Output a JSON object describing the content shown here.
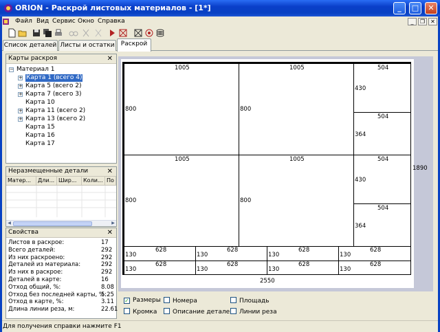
{
  "window": {
    "title": "ORION - Раскрой листовых материалов - [1*]",
    "minimize": "_",
    "maximize": "□",
    "close": "✕"
  },
  "menu": [
    "Файл",
    "Вид",
    "Сервис",
    "Окно",
    "Справка"
  ],
  "tabs": [
    "Список деталей",
    "Листы и остатки",
    "Раскрой"
  ],
  "cards_panel": {
    "title": "Карты раскроя",
    "close": "✕",
    "root": "Материал 1",
    "items": [
      {
        "label": "Карта  1  (всего 4)",
        "expandable": true,
        "selected": true
      },
      {
        "label": "Карта  5  (всего 2)",
        "expandable": true,
        "selected": false
      },
      {
        "label": "Карта  7  (всего 3)",
        "expandable": true,
        "selected": false
      },
      {
        "label": "Карта  10",
        "expandable": false,
        "selected": false
      },
      {
        "label": "Карта  11  (всего 2)",
        "expandable": true,
        "selected": false
      },
      {
        "label": "Карта  13  (всего 2)",
        "expandable": true,
        "selected": false
      },
      {
        "label": "Карта  15",
        "expandable": false,
        "selected": false
      },
      {
        "label": "Карта  16",
        "expandable": false,
        "selected": false
      },
      {
        "label": "Карта  17",
        "expandable": false,
        "selected": false
      }
    ]
  },
  "unplaced_panel": {
    "title": "Неразмещенные детали",
    "close": "✕",
    "columns": [
      "Матер...",
      "Дли...",
      "Шир...",
      "Коли...",
      "По"
    ]
  },
  "props_panel": {
    "title": "Свойства",
    "close": "✕",
    "rows": [
      {
        "label": "Листов в раскрое:",
        "value": "17"
      },
      {
        "label": "Всего деталей:",
        "value": "292"
      },
      {
        "label": "Из них раскроено:",
        "value": "292"
      },
      {
        "label": "Деталей из материала:",
        "value": "292"
      },
      {
        "label": "Из них в раскрое:",
        "value": "292"
      },
      {
        "label": "Деталей в карте:",
        "value": "16"
      },
      {
        "label": "Отход общий, %:",
        "value": "8.08"
      },
      {
        "label": "Отход без последней карты, %:",
        "value": "5.25"
      },
      {
        "label": "Отход в карте, %:",
        "value": "3.11"
      },
      {
        "label": "Длина линии реза, м:",
        "value": "22.61"
      }
    ]
  },
  "layout": {
    "sheet_width_label": "2550",
    "sheet_height_label": "1890",
    "big_w": "1005",
    "big_h": "800",
    "small_w": "504",
    "small_h1": "430",
    "small_h2": "364",
    "strip_w": "628",
    "strip_h": "130"
  },
  "options": [
    {
      "label": "Размеры",
      "checked": true
    },
    {
      "label": "Номера",
      "checked": false
    },
    {
      "label": "Площадь",
      "checked": false
    },
    {
      "label": "Кромка",
      "checked": false
    },
    {
      "label": "Описание деталей",
      "checked": false
    },
    {
      "label": "Линии реза",
      "checked": false
    }
  ],
  "status": "Для получения справки нажмите F1",
  "colors": {
    "title_bar": "#0841c3",
    "selection": "#316ac5",
    "canvas_bg": "#c5c8d8"
  }
}
